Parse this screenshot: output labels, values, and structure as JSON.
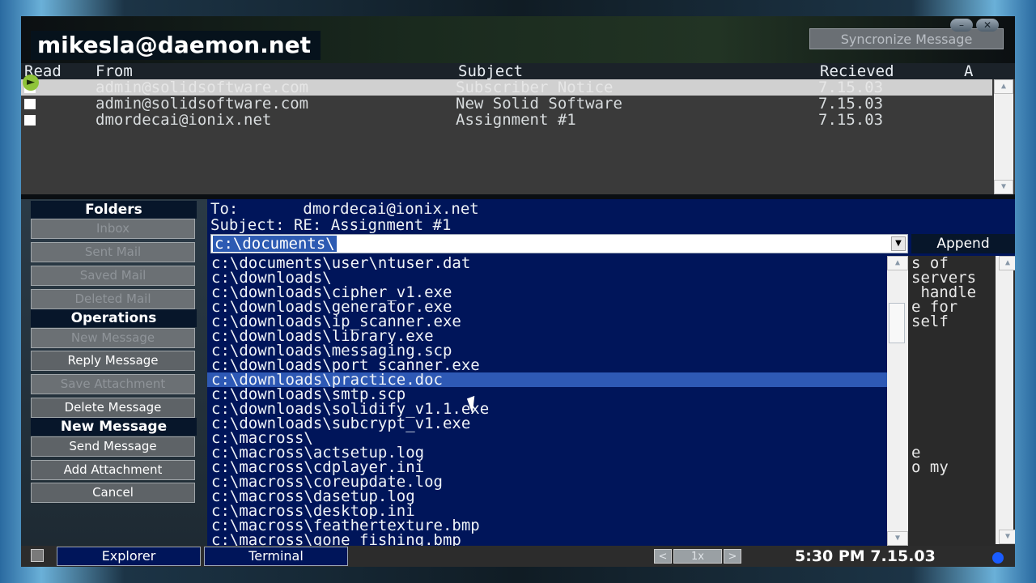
{
  "account": "mikesla@daemon.net",
  "sync_button": "Syncronize Message",
  "columns": {
    "read": "Read",
    "from": "From",
    "subject": "Subject",
    "received": "Recieved",
    "attach": "A"
  },
  "messages": [
    {
      "from": "admin@solidsoftware.com",
      "subject": "Subscriber Notice",
      "received": "7.15.03"
    },
    {
      "from": "admin@solidsoftware.com",
      "subject": "New Solid Software",
      "received": "7.15.03"
    },
    {
      "from": "dmordecai@ionix.net",
      "subject": "Assignment #1",
      "received": "7.15.03"
    }
  ],
  "panel": {
    "folders_title": "Folders",
    "folders": [
      "Inbox",
      "Sent Mail",
      "Saved Mail",
      "Deleted Mail"
    ],
    "operations_title": "Operations",
    "operations": [
      "New Message",
      "Reply Message",
      "Save Attachment",
      "Delete Message"
    ],
    "new_message_title": "New Message",
    "new_message_ops": [
      "Send Message",
      "Add Attachment",
      "Cancel"
    ]
  },
  "compose": {
    "to_label": "To:",
    "to_value": "dmordecai@ionix.net",
    "subject_label": "Subject:",
    "subject_value": "RE: Assignment #1",
    "path_value": "c:\\documents\\",
    "append_button": "Append",
    "files": [
      "c:\\documents\\user\\ntuser.dat",
      "c:\\downloads\\",
      "c:\\downloads\\cipher_v1.exe",
      "c:\\downloads\\generator.exe",
      "c:\\downloads\\ip_scanner.exe",
      "c:\\downloads\\library.exe",
      "c:\\downloads\\messaging.scp",
      "c:\\downloads\\port_scanner.exe",
      "c:\\downloads\\practice.doc",
      "c:\\downloads\\smtp.scp",
      "c:\\downloads\\solidify_v1.1.exe",
      "c:\\downloads\\subcrypt_v1.exe",
      "c:\\macross\\",
      "c:\\macross\\actsetup.log",
      "c:\\macross\\cdplayer.ini",
      "c:\\macross\\coreupdate.log",
      "c:\\macross\\dasetup.log",
      "c:\\macross\\desktop.ini",
      "c:\\macross\\feathertexture.bmp",
      "c:\\macross\\gone_fishing.bmp"
    ],
    "selected_file": "c:\\downloads\\practice.doc",
    "body_fragments": [
      "s of",
      "servers",
      " handle",
      "e for",
      "self",
      "e",
      "o my"
    ]
  },
  "taskbar": {
    "explorer": "Explorer",
    "terminal": "Terminal",
    "zoom": "1x",
    "clock": "5:30 PM 7.15.03"
  }
}
